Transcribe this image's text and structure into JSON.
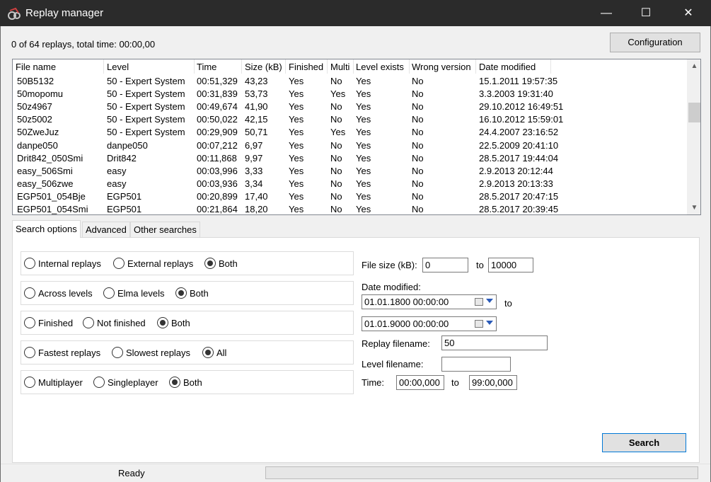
{
  "window": {
    "title": "Replay manager",
    "minimize": "—",
    "maximize": "☐",
    "close": "✕"
  },
  "summary": "0 of 64 replays, total time: 00:00,00",
  "configuration_button": "Configuration",
  "list": {
    "columns": [
      "File name",
      "Level",
      "Time",
      "Size (kB)",
      "Finished",
      "Multi",
      "Level exists",
      "Wrong version",
      "Date modified"
    ],
    "rows": [
      [
        "50B5132",
        "50 - Expert System",
        "00:51,329",
        "43,23",
        "Yes",
        "No",
        "Yes",
        "No",
        "15.1.2011 19:57:35"
      ],
      [
        "50mopomu",
        "50 - Expert System",
        "00:31,839",
        "53,73",
        "Yes",
        "Yes",
        "Yes",
        "No",
        "3.3.2003 19:31:40"
      ],
      [
        "50z4967",
        "50 - Expert System",
        "00:49,674",
        "41,90",
        "Yes",
        "No",
        "Yes",
        "No",
        "29.10.2012 16:49:51"
      ],
      [
        "50z5002",
        "50 - Expert System",
        "00:50,022",
        "42,15",
        "Yes",
        "No",
        "Yes",
        "No",
        "16.10.2012 15:59:01"
      ],
      [
        "50ZweJuz",
        "50 - Expert System",
        "00:29,909",
        "50,71",
        "Yes",
        "Yes",
        "Yes",
        "No",
        "24.4.2007 23:16:52"
      ],
      [
        "danpe050",
        "danpe050",
        "00:07,212",
        "6,97",
        "Yes",
        "No",
        "Yes",
        "No",
        "22.5.2009 20:41:10"
      ],
      [
        "Drit842_050Smi",
        "Drit842",
        "00:11,868",
        "9,97",
        "Yes",
        "No",
        "Yes",
        "No",
        "28.5.2017 19:44:04"
      ],
      [
        "easy_506Smi",
        "easy",
        "00:03,996",
        "3,33",
        "Yes",
        "No",
        "Yes",
        "No",
        "2.9.2013 20:12:44"
      ],
      [
        "easy_506zwe",
        "easy",
        "00:03,936",
        "3,34",
        "Yes",
        "No",
        "Yes",
        "No",
        "2.9.2013 20:13:33"
      ],
      [
        "EGP501_054Bje",
        "EGP501",
        "00:20,899",
        "17,40",
        "Yes",
        "No",
        "Yes",
        "No",
        "28.5.2017 20:47:15"
      ],
      [
        "EGP501_054Smi",
        "EGP501",
        "00:21,864",
        "18,20",
        "Yes",
        "No",
        "Yes",
        "No",
        "28.5.2017 20:39:45"
      ]
    ],
    "scroll_up": "▲",
    "scroll_down": "▼"
  },
  "tabs": [
    "Search options",
    "Advanced",
    "Other searches"
  ],
  "options": [
    {
      "choices": [
        "Internal replays",
        "External replays",
        "Both"
      ],
      "selected": 2
    },
    {
      "choices": [
        "Across levels",
        "Elma levels",
        "Both"
      ],
      "selected": 2
    },
    {
      "choices": [
        "Finished",
        "Not finished",
        "Both"
      ],
      "selected": 2
    },
    {
      "choices": [
        "Fastest replays",
        "Slowest replays",
        "All"
      ],
      "selected": 2
    },
    {
      "choices": [
        "Multiplayer",
        "Singleplayer",
        "Both"
      ],
      "selected": 2
    }
  ],
  "filters": {
    "file_size_label": "File size (kB):",
    "file_size_from": "0",
    "to_label": "to",
    "file_size_to": "10000",
    "date_modified_label": "Date modified:",
    "date_from": "01.01.1800 00:00:00",
    "date_to": "01.01.9000 00:00:00",
    "replay_filename_label": "Replay filename:",
    "replay_filename": "50",
    "level_filename_label": "Level filename:",
    "level_filename": "",
    "time_label": "Time:",
    "time_from": "00:00,000",
    "time_to": "99:00,000"
  },
  "search_button": "Search",
  "status": "Ready"
}
